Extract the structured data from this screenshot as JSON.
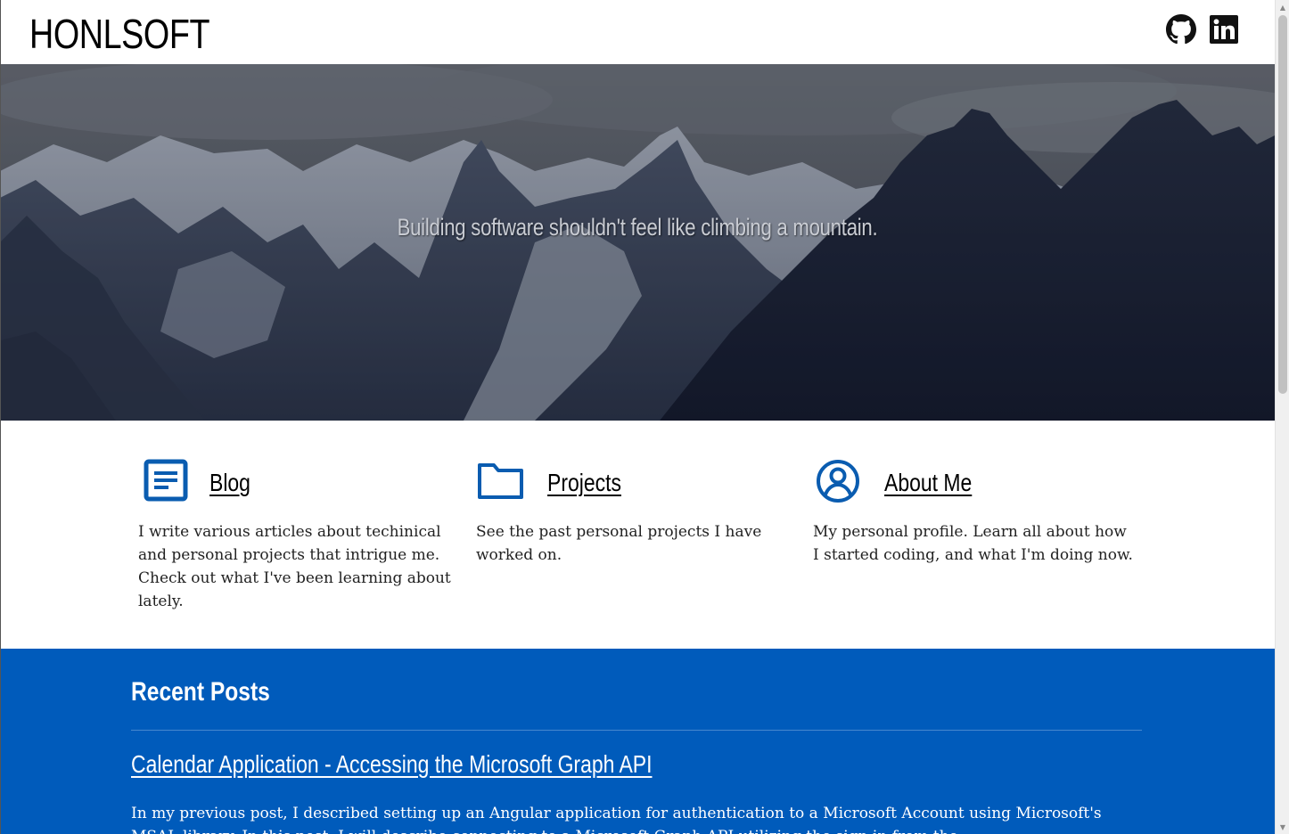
{
  "header": {
    "brand": "HONLSOFT",
    "social": [
      {
        "icon": "github-icon",
        "label": "GitHub"
      },
      {
        "icon": "linkedin-icon",
        "label": "LinkedIn"
      }
    ]
  },
  "hero": {
    "tagline": "Building software shouldn't feel like climbing a mountain."
  },
  "features": [
    {
      "icon": "document-icon",
      "title": "Blog",
      "text": "I write various articles about techinical and personal projects that intrigue me. Check out what I've been learning about lately."
    },
    {
      "icon": "folder-icon",
      "title": "Projects",
      "text": "See the past personal projects I have worked on."
    },
    {
      "icon": "user-circle-icon",
      "title": "About Me",
      "text": "My personal profile. Learn all about how I started coding, and what I'm doing now."
    }
  ],
  "recent_posts": {
    "heading": "Recent Posts",
    "posts": [
      {
        "title": "Calendar Application - Accessing the Microsoft Graph API",
        "excerpt": "In my previous post, I described setting up an Angular application for authentication to a Microsoft Account using Microsoft's MSAL library. In this post, I will describe connecting to a Microsoft Graph API utilizing the sign in from the"
      }
    ]
  },
  "colors": {
    "accent_blue": "#005bbb",
    "icon_blue": "#0a5cb0",
    "text_dark": "#222222"
  }
}
